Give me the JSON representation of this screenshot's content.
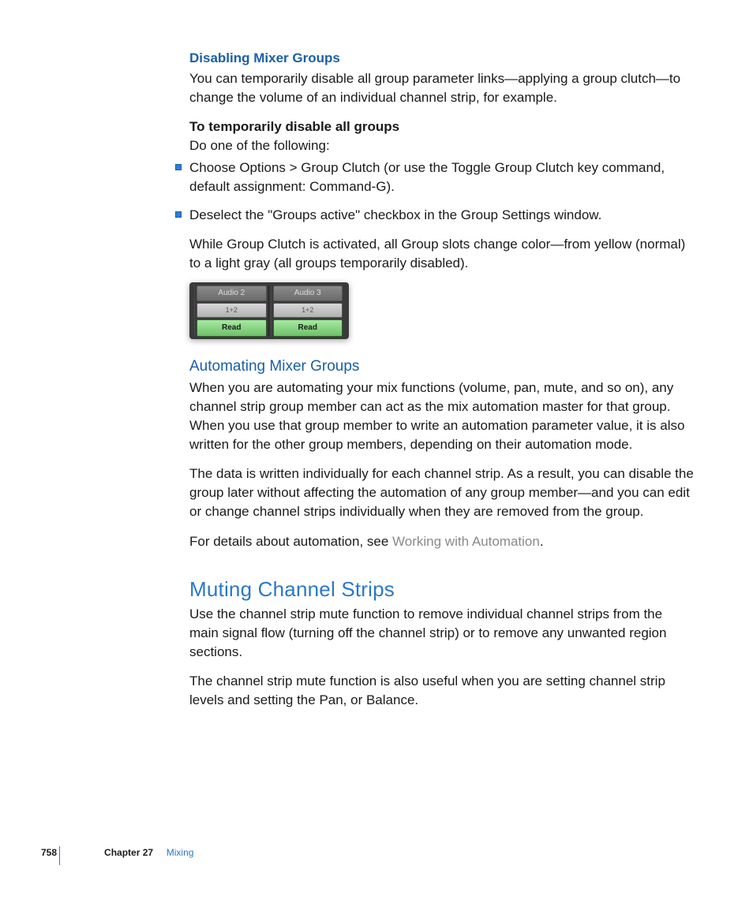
{
  "section1": {
    "heading": "Disabling Mixer Groups",
    "p1": "You can temporarily disable all group parameter links—applying a group clutch—to change the volume of an individual channel strip, for example.",
    "boldline": "To temporarily disable all groups",
    "subline": "Do one of the following:",
    "b1": "Choose Options > Group Clutch (or use the Toggle Group Clutch key command, default assignment:  Command-G).",
    "b2": "Deselect the \"Groups active\" checkbox in the Group Settings window.",
    "p2": "While Group Clutch is activated, all Group slots change color—from yellow (normal) to a light gray (all groups temporarily disabled)."
  },
  "figure": {
    "strip1": {
      "name": "Audio 2",
      "group": "1+2",
      "mode": "Read"
    },
    "strip2": {
      "name": "Audio 3",
      "group": "1+2",
      "mode": "Read"
    }
  },
  "section2": {
    "heading": "Automating Mixer Groups",
    "p1": "When you are automating your mix functions (volume, pan, mute, and so on), any channel strip group member can act as the mix automation master for that group. When you use that group member to write an automation parameter value, it is also written for the other group members, depending on their automation mode.",
    "p2": "The data is written individually for each channel strip. As a result, you can disable the group later without affecting the automation of any group member—and you can edit or change channel strips individually when they are removed from the group.",
    "p3_pre": "For details about automation, see ",
    "p3_link": "Working with Automation",
    "p3_post": "."
  },
  "section3": {
    "heading": "Muting Channel Strips",
    "p1": "Use the channel strip mute function to remove individual channel strips from the main signal flow (turning off the channel strip) or to remove any unwanted region sections.",
    "p2": "The channel strip mute function is also useful when you are setting channel strip levels and setting the Pan, or Balance."
  },
  "footer": {
    "page": "758",
    "chapter": "Chapter 27",
    "title": "Mixing"
  }
}
